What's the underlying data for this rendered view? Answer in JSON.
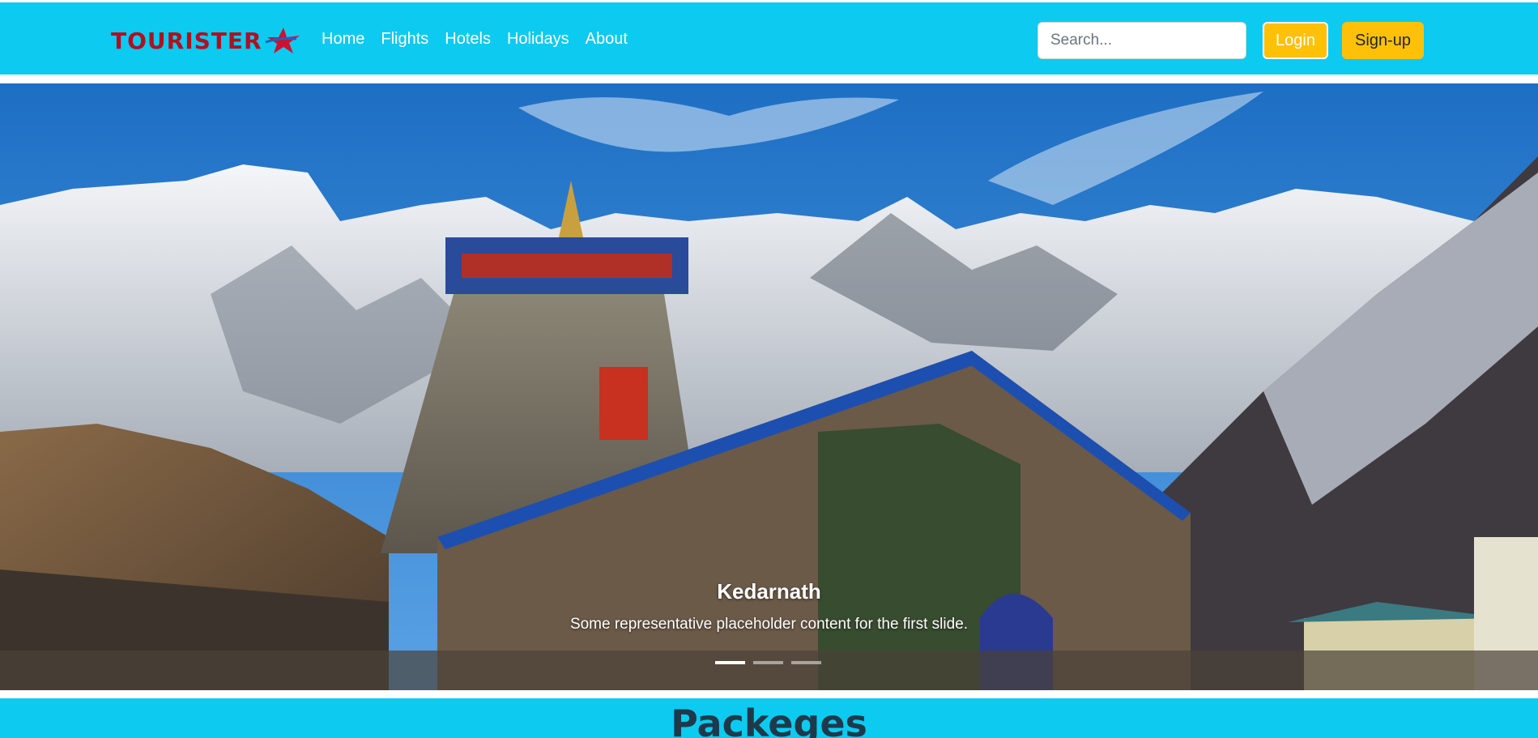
{
  "brand": {
    "name": "TOURISTER",
    "star_icon": "star-icon",
    "color": "#b01020"
  },
  "nav": {
    "links": [
      "Home",
      "Flights",
      "Hotels",
      "Holidays",
      "About"
    ],
    "bg_color": "#0dcaf0"
  },
  "search": {
    "placeholder": "Search...",
    "value": ""
  },
  "buttons": {
    "login": "Login",
    "signup": "Sign-up",
    "accent": "#ffc107"
  },
  "carousel": {
    "slide_title": "Kedarnath",
    "slide_text": "Some representative placeholder content for the first slide.",
    "slide_count": 3,
    "active_index": 0
  },
  "packages": {
    "title": "Packeges"
  }
}
